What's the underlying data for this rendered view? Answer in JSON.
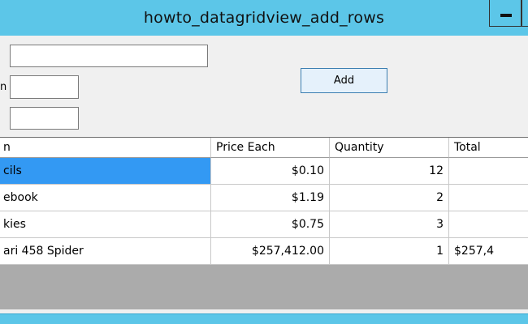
{
  "window": {
    "title": "howto_datagridview_add_rows"
  },
  "form": {
    "label_item": "",
    "label_price": "n",
    "label_qty": "",
    "item_value": "",
    "price_value": "",
    "qty_value": "",
    "add_label": "Add"
  },
  "grid": {
    "columns": [
      "n",
      "Price Each",
      "Quantity",
      "Total"
    ],
    "rows": [
      {
        "item": "cils",
        "price": "$0.10",
        "qty": "12",
        "total": ""
      },
      {
        "item": "ebook",
        "price": "$1.19",
        "qty": "2",
        "total": ""
      },
      {
        "item": "kies",
        "price": "$0.75",
        "qty": "3",
        "total": ""
      },
      {
        "item": "ari 458 Spider",
        "price": "$257,412.00",
        "qty": "1",
        "total": "$257,4"
      }
    ],
    "selected_row": 0
  },
  "colors": {
    "titlebar": "#5cc6e8",
    "selection": "#3399f3",
    "grid_background": "#ababab"
  }
}
